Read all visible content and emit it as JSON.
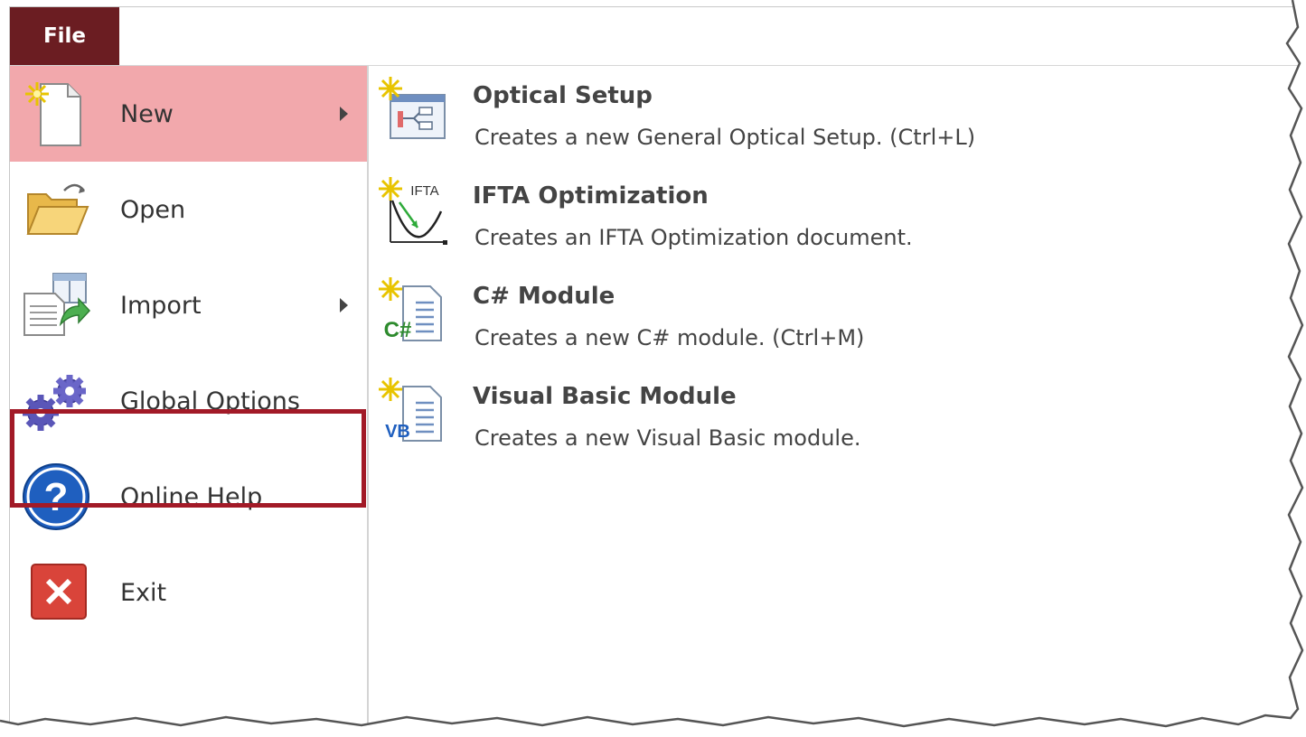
{
  "file_tab": {
    "label": "File"
  },
  "sidebar": {
    "items": [
      {
        "label": "New",
        "icon": "new-document-icon",
        "has_submenu": true,
        "active": true
      },
      {
        "label": "Open",
        "icon": "folder-open-icon",
        "has_submenu": false
      },
      {
        "label": "Import",
        "icon": "import-icon",
        "has_submenu": true
      },
      {
        "label": "Global Options",
        "icon": "gears-icon",
        "has_submenu": false,
        "highlighted": true
      },
      {
        "label": "Online Help",
        "icon": "help-icon",
        "has_submenu": false
      },
      {
        "label": "Exit",
        "icon": "exit-icon",
        "has_submenu": false
      }
    ]
  },
  "new_menu": {
    "commands": [
      {
        "title": "Optical Setup",
        "description": "Creates a new General Optical Setup. (Ctrl+L)",
        "icon": "optical-setup-icon"
      },
      {
        "title": "IFTA Optimization",
        "description": "Creates an IFTA Optimization document.",
        "icon": "ifta-optimization-icon",
        "icon_text": "IFTA"
      },
      {
        "title": "C# Module",
        "description": "Creates a new C# module. (Ctrl+M)",
        "icon": "csharp-module-icon",
        "icon_text": "C#"
      },
      {
        "title": "Visual Basic Module",
        "description": "Creates a new Visual Basic module.",
        "icon": "vb-module-icon",
        "icon_text": "VB"
      }
    ]
  },
  "colors": {
    "file_tab_bg": "#6b1d22",
    "active_item_bg": "#f2a8ac",
    "highlight_border": "#a21a27"
  }
}
